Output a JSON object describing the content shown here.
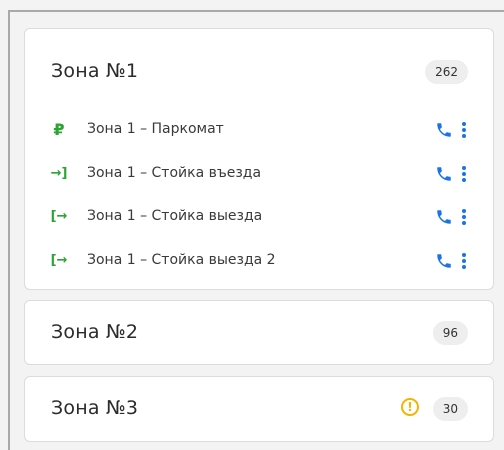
{
  "zones": [
    {
      "title": "Зона №1",
      "count": "262",
      "devices": [
        {
          "label": "Зона 1 – Паркомат",
          "icon": "ruble-icon",
          "glyph": "₽"
        },
        {
          "label": "Зона 1 – Стойка въезда",
          "icon": "entry-icon",
          "glyph": "→]"
        },
        {
          "label": "Зона 1 – Стойка выезда",
          "icon": "exit-icon",
          "glyph": "[→"
        },
        {
          "label": "Зона 1 – Стойка выезда 2",
          "icon": "exit-icon",
          "glyph": "[→"
        }
      ]
    },
    {
      "title": "Зона №2",
      "count": "96"
    },
    {
      "title": "Зона №3",
      "count": "30",
      "warning": "!"
    }
  ],
  "colors": {
    "accent": "#1a73e8",
    "device_icon": "#2aa531",
    "warning": "#f4b400"
  }
}
